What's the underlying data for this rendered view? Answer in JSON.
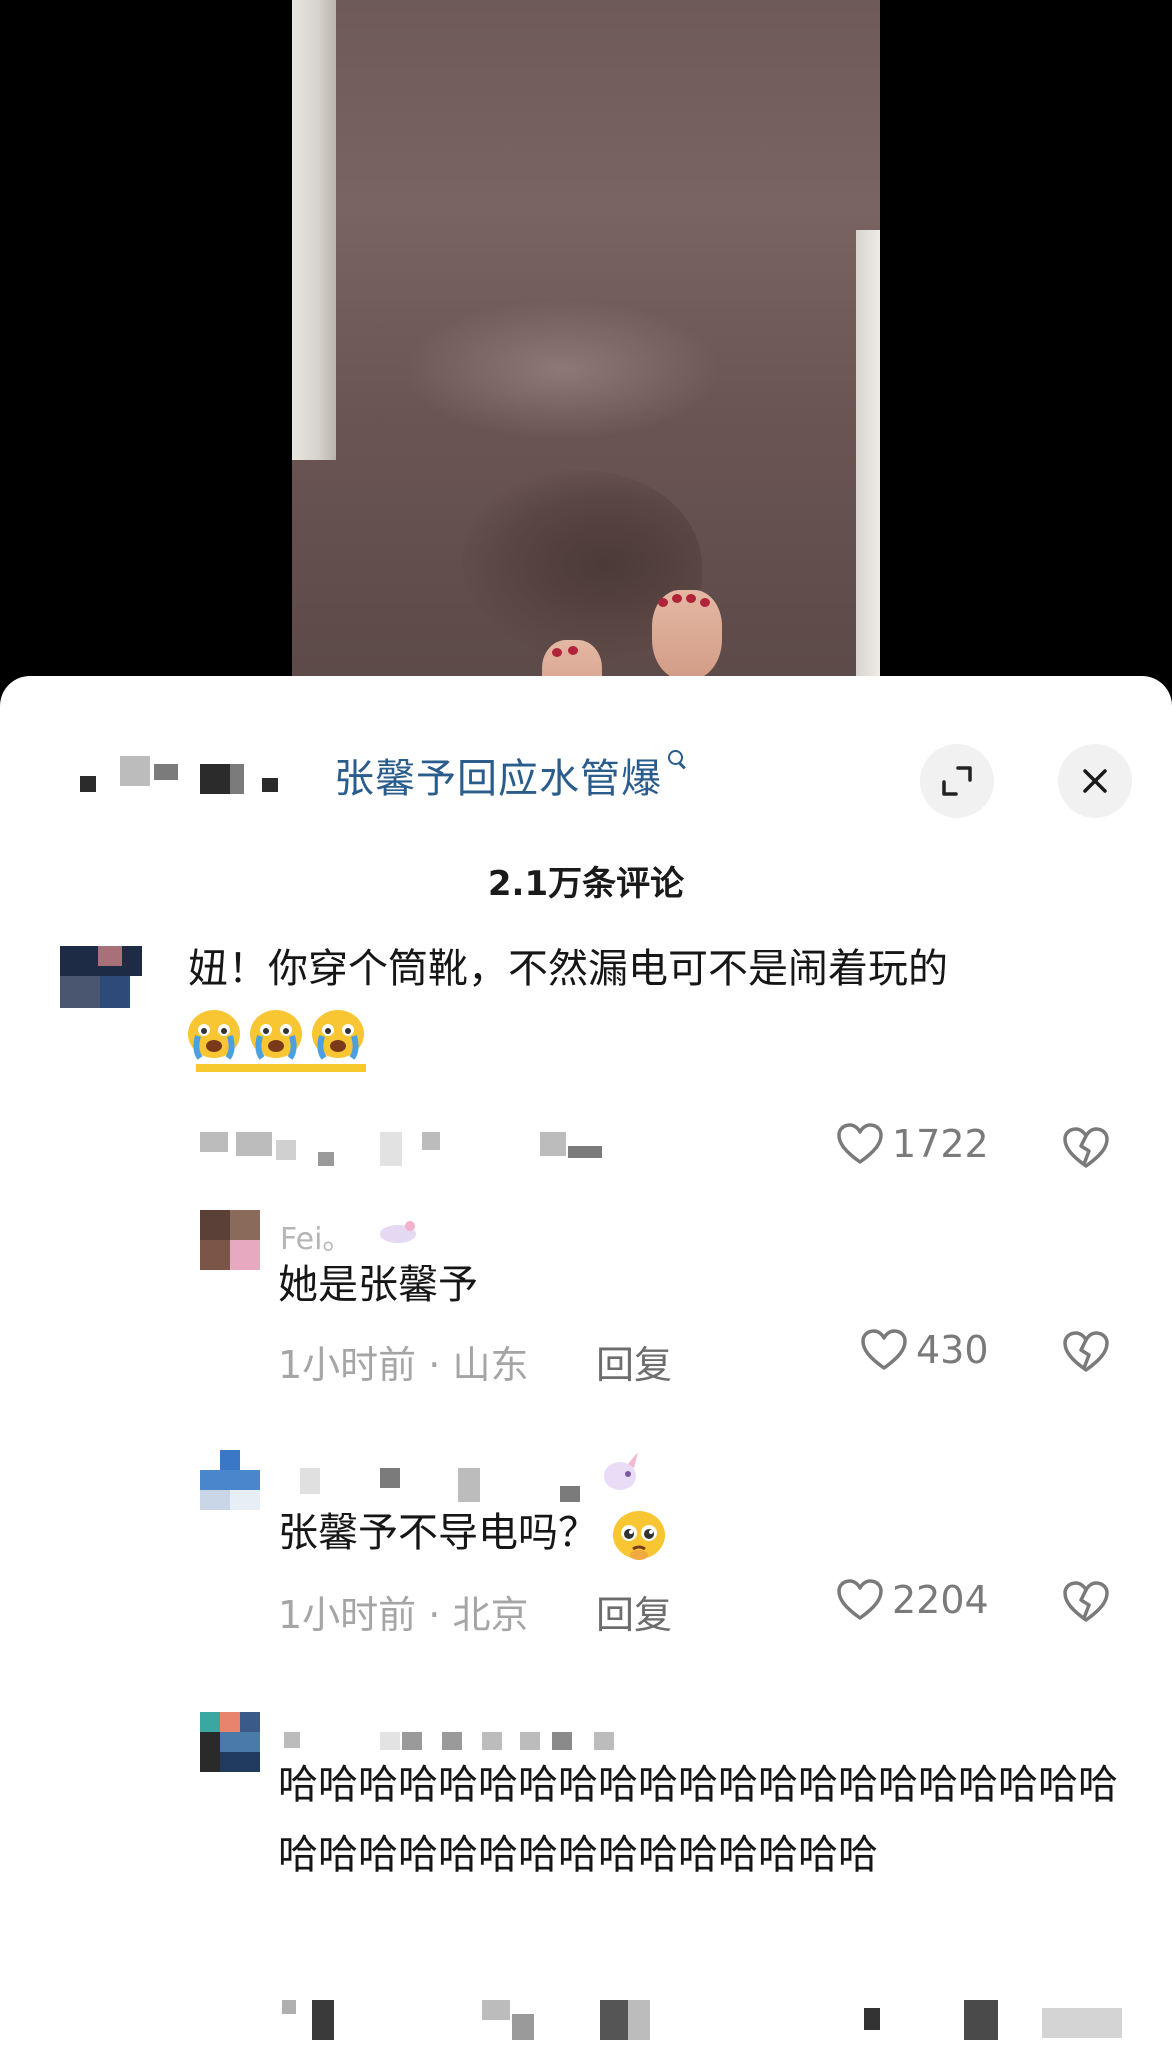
{
  "video": {
    "description_icon": "video-frame"
  },
  "header": {
    "search_link": "张馨予回应水管爆",
    "expand_icon": "expand-icon",
    "close_icon": "close-icon"
  },
  "comments_count": "2.1万条评论",
  "comments": [
    {
      "text": "妞！你穿个筒靴，不然漏电可不是闹着玩的",
      "emoji_count": 3,
      "likes": "1722"
    },
    {
      "username": "Fei。",
      "text": "她是张馨予",
      "time": "1小时前",
      "location": "山东",
      "reply_label": "回复",
      "likes": "430"
    },
    {
      "text": "张馨予不导电吗？",
      "time": "1小时前",
      "location": "北京",
      "reply_label": "回复",
      "likes": "2204"
    },
    {
      "text": "哈哈哈哈哈哈哈哈哈哈哈哈哈哈哈哈哈哈哈哈哈哈哈哈哈哈哈哈哈哈哈哈哈哈哈哈"
    }
  ],
  "meta_separator": " · ",
  "colors": {
    "link": "#2a5c8c",
    "meta": "#a5a5a5",
    "reply": "#6d6d6d"
  }
}
